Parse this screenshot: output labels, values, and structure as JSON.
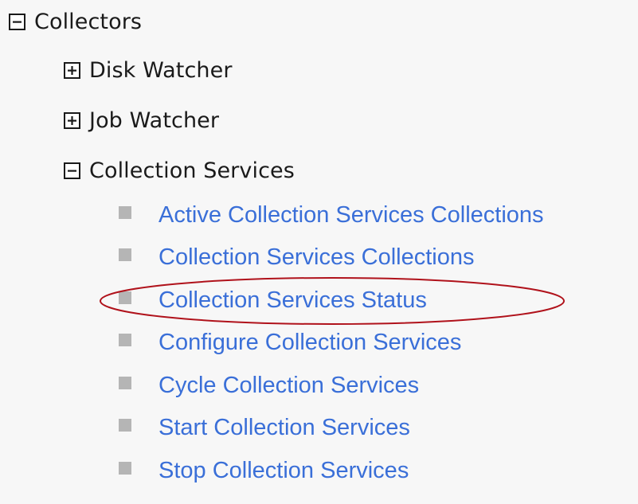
{
  "tree": {
    "root": {
      "label": "Collectors",
      "toggle_icon": "minus-box-icon",
      "children": [
        {
          "label": "Disk Watcher",
          "toggle_icon": "plus-box-icon"
        },
        {
          "label": "Job Watcher",
          "toggle_icon": "plus-box-icon"
        },
        {
          "label": "Collection Services",
          "toggle_icon": "minus-box-icon",
          "items": [
            {
              "label": "Active Collection Services Collections"
            },
            {
              "label": "Collection Services Collections"
            },
            {
              "label": "Collection Services Status"
            },
            {
              "label": "Configure Collection Services"
            },
            {
              "label": "Cycle Collection Services"
            },
            {
              "label": "Start Collection Services"
            },
            {
              "label": "Stop Collection Services"
            }
          ]
        }
      ]
    }
  },
  "colors": {
    "link": "#3a6fd8",
    "bullet": "#b5b5b5",
    "highlight": "#b0121b"
  },
  "highlighted_item": "Collection Services Status"
}
